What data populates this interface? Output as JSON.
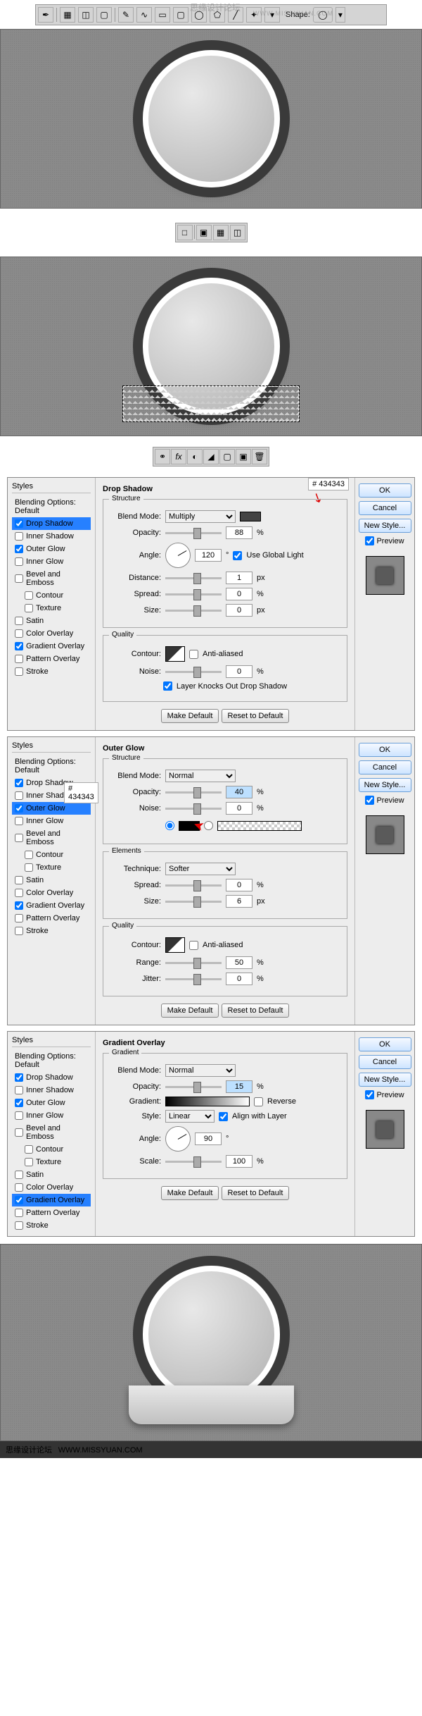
{
  "watermark": "思缘设计论坛",
  "watermark_url": "WWW.MISSYUAN.COM",
  "toolbar_shape": "Shape:",
  "toolbar2_items": [
    "□",
    "▣",
    "▦",
    "◫"
  ],
  "fx_items": [
    "👁",
    "fx",
    "◐",
    "◢",
    "◼",
    "▣",
    "🗑"
  ],
  "styles_header": "Styles",
  "blending_default": "Blending Options: Default",
  "styles_list": [
    {
      "label": "Drop Shadow",
      "checked": true
    },
    {
      "label": "Inner Shadow",
      "checked": false
    },
    {
      "label": "Outer Glow",
      "checked": true
    },
    {
      "label": "Inner Glow",
      "checked": false
    },
    {
      "label": "Bevel and Emboss",
      "checked": false
    },
    {
      "label": "Contour",
      "checked": false,
      "indent": true
    },
    {
      "label": "Texture",
      "checked": false,
      "indent": true
    },
    {
      "label": "Satin",
      "checked": false
    },
    {
      "label": "Color Overlay",
      "checked": false
    },
    {
      "label": "Gradient Overlay",
      "checked": true
    },
    {
      "label": "Pattern Overlay",
      "checked": false
    },
    {
      "label": "Stroke",
      "checked": false
    }
  ],
  "color_hex": "434343",
  "buttons": {
    "ok": "OK",
    "cancel": "Cancel",
    "newstyle": "New Style...",
    "preview": "Preview",
    "make_default": "Make Default",
    "reset": "Reset to Default"
  },
  "labels": {
    "blend_mode": "Blend Mode:",
    "opacity": "Opacity:",
    "angle": "Angle:",
    "distance": "Distance:",
    "spread": "Spread:",
    "size": "Size:",
    "noise": "Noise:",
    "contour": "Contour:",
    "technique": "Technique:",
    "range": "Range:",
    "jitter": "Jitter:",
    "gradient": "Gradient:",
    "style": "Style:",
    "scale": "Scale:",
    "structure": "Structure",
    "quality": "Quality",
    "elements": "Elements",
    "gradient_sec": "Gradient"
  },
  "checks": {
    "global_light": "Use Global Light",
    "anti_aliased": "Anti-aliased",
    "knockout": "Layer Knocks Out Drop Shadow",
    "reverse": "Reverse",
    "align": "Align with Layer"
  },
  "drop_shadow": {
    "title": "Drop Shadow",
    "blend": "Multiply",
    "opacity": "88",
    "angle": "120",
    "distance": "1",
    "spread": "0",
    "size": "0",
    "noise": "0"
  },
  "outer_glow": {
    "title": "Outer Glow",
    "blend": "Normal",
    "opacity": "40",
    "noise": "0",
    "technique": "Softer",
    "spread": "0",
    "size": "6",
    "range": "50",
    "jitter": "0"
  },
  "gradient_overlay": {
    "title": "Gradient Overlay",
    "blend": "Normal",
    "opacity": "15",
    "style": "Linear",
    "angle": "90",
    "scale": "100"
  },
  "unit_pct": "%",
  "unit_px": "px",
  "unit_deg": "°",
  "hash": "#"
}
